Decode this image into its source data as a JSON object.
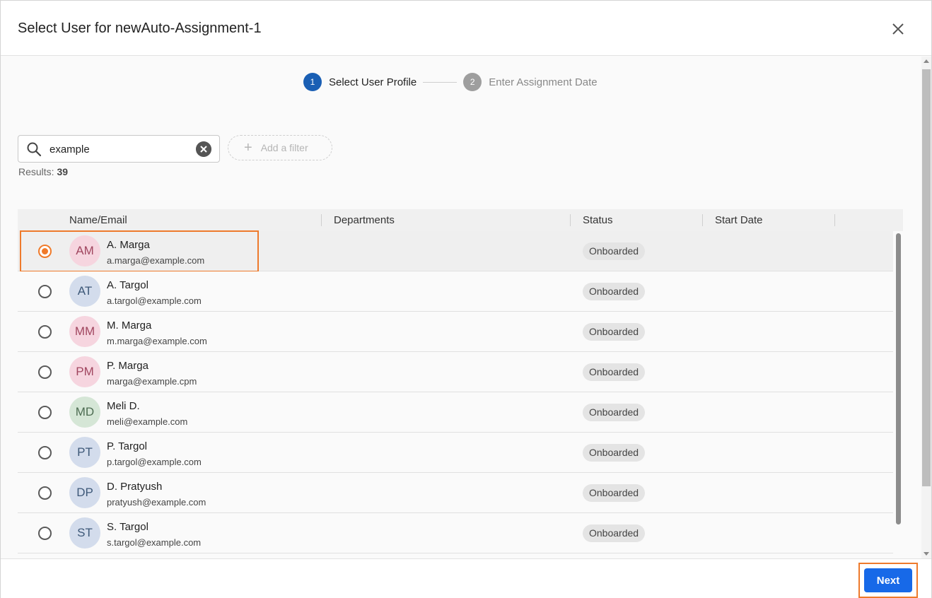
{
  "dialog": {
    "title": "Select User for newAuto-Assignment-1",
    "close_icon": "close-icon"
  },
  "stepper": {
    "steps": [
      {
        "number": "1",
        "label": "Select User Profile",
        "state": "active"
      },
      {
        "number": "2",
        "label": "Enter Assignment Date",
        "state": "inactive"
      }
    ]
  },
  "search": {
    "value": "example",
    "placeholder": "",
    "icon": "search-icon",
    "clear_icon": "clear-icon"
  },
  "add_filter": {
    "label": "Add a filter",
    "icon": "plus-icon"
  },
  "results": {
    "label": "Results:",
    "count": "39"
  },
  "table": {
    "columns": [
      "Name/Email",
      "Departments",
      "Status",
      "Start Date"
    ],
    "rows": [
      {
        "initials": "AM",
        "name": "A. Marga",
        "email": "a.marga@example.com",
        "department": "",
        "status": "Onboarded",
        "start_date": "",
        "selected": true,
        "avatar_bg": "#f6d5df",
        "avatar_fg": "#a0465f"
      },
      {
        "initials": "AT",
        "name": "A. Targol",
        "email": "a.targol@example.com",
        "department": "",
        "status": "Onboarded",
        "start_date": "",
        "selected": false,
        "avatar_bg": "#d3dcec",
        "avatar_fg": "#3d5878"
      },
      {
        "initials": "MM",
        "name": "M. Marga",
        "email": "m.marga@example.com",
        "department": "",
        "status": "Onboarded",
        "start_date": "",
        "selected": false,
        "avatar_bg": "#f6d5df",
        "avatar_fg": "#a0465f"
      },
      {
        "initials": "PM",
        "name": "P. Marga",
        "email": "marga@example.cpm",
        "department": "",
        "status": "Onboarded",
        "start_date": "",
        "selected": false,
        "avatar_bg": "#f6d5df",
        "avatar_fg": "#a0465f"
      },
      {
        "initials": "MD",
        "name": "Meli D.",
        "email": "meli@example.com",
        "department": "",
        "status": "Onboarded",
        "start_date": "",
        "selected": false,
        "avatar_bg": "#d5e6d6",
        "avatar_fg": "#4d6c52"
      },
      {
        "initials": "PT",
        "name": "P. Targol",
        "email": "p.targol@example.com",
        "department": "",
        "status": "Onboarded",
        "start_date": "",
        "selected": false,
        "avatar_bg": "#d3dcec",
        "avatar_fg": "#3d5878"
      },
      {
        "initials": "DP",
        "name": "D. Pratyush",
        "email": "pratyush@example.com",
        "department": "",
        "status": "Onboarded",
        "start_date": "",
        "selected": false,
        "avatar_bg": "#d3dcec",
        "avatar_fg": "#3d5878"
      },
      {
        "initials": "ST",
        "name": "S. Targol",
        "email": "s.targol@example.com",
        "department": "",
        "status": "Onboarded",
        "start_date": "",
        "selected": false,
        "avatar_bg": "#d3dcec",
        "avatar_fg": "#3d5878"
      }
    ]
  },
  "footer": {
    "next_label": "Next"
  },
  "colors": {
    "primary_blue": "#1769e8",
    "step_active": "#1a5fb4",
    "highlight_orange": "#ee7a2c",
    "badge_bg": "#e4e4e4"
  }
}
